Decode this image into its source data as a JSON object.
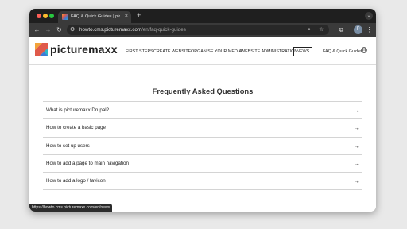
{
  "browser": {
    "tab_title": "FAQ & Quick Guides | picturem",
    "tab_close_icon": "×",
    "new_tab_icon": "+",
    "tab_search_icon": "⌄",
    "url_host": "howto.cms.picturemaxx.com",
    "url_path": "/en/faq-quick-guides",
    "status_url": "https://howto.cms.picturemaxx.com/en/news",
    "icons": {
      "back": "←",
      "forward": "→",
      "reload": "↻",
      "site_info": "⚙",
      "zoom": "⌕",
      "bookmark": "☆",
      "extensions": "⧉",
      "profile": "P",
      "menu": "⋮"
    }
  },
  "site": {
    "brand": "picturemaxx",
    "nav": [
      {
        "label": "FIRST STEPS"
      },
      {
        "label": "CREATE WEBSITE"
      },
      {
        "label": "ORGANISE YOUR MEDIA"
      },
      {
        "label": "WEBSITE ADMINISTRATION"
      },
      {
        "label": "NEWS"
      }
    ],
    "faq_link": "FAQ & Quick Guides"
  },
  "main": {
    "title": "Frequently Asked Questions",
    "arrow_icon": "→",
    "questions": [
      {
        "text": "What is picturemaxx Drupal?"
      },
      {
        "text": "How to create a basic page"
      },
      {
        "text": "How to set up users"
      },
      {
        "text": "How to add a page to main navigation"
      },
      {
        "text": "How to add a logo / favicon"
      }
    ]
  },
  "colors": {
    "chrome_dark": "#1f1f1f",
    "toolbar": "#3a3a3a",
    "traffic_red": "#ff5f57",
    "traffic_yellow": "#febc2e",
    "traffic_green": "#28c840"
  }
}
